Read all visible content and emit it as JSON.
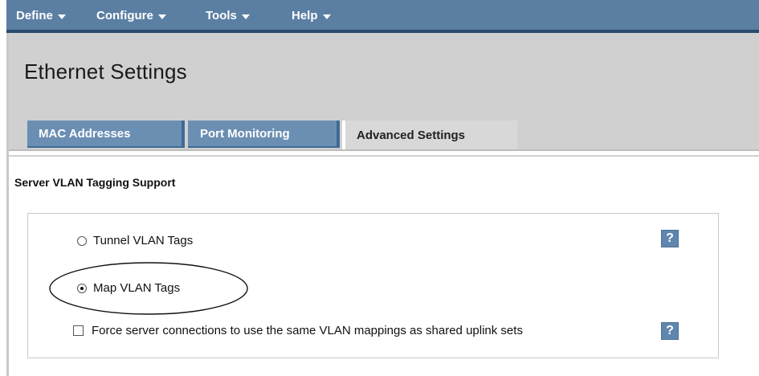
{
  "menu": {
    "items": [
      {
        "label": "Define"
      },
      {
        "label": "Configure"
      },
      {
        "label": "Tools"
      },
      {
        "label": "Help"
      }
    ]
  },
  "page": {
    "title": "Ethernet Settings"
  },
  "tabs": [
    {
      "label": "MAC Addresses",
      "active": false
    },
    {
      "label": "Port Monitoring",
      "active": false
    },
    {
      "label": "Advanced Settings",
      "active": true
    }
  ],
  "section": {
    "heading": "Server VLAN Tagging Support"
  },
  "options": {
    "tunnel": {
      "label": "Tunnel VLAN Tags",
      "checked": false
    },
    "map": {
      "label": "Map VLAN Tags",
      "checked": true
    },
    "force": {
      "label": "Force server connections to use the same VLAN mappings as shared uplink sets",
      "checked": false
    }
  },
  "help": {
    "symbol": "?"
  },
  "colors": {
    "menubar": "#5b7fa3",
    "tab_inactive": "#6b8fb3",
    "tab_active": "#d8d8d8",
    "help_button": "#5f86ad"
  }
}
